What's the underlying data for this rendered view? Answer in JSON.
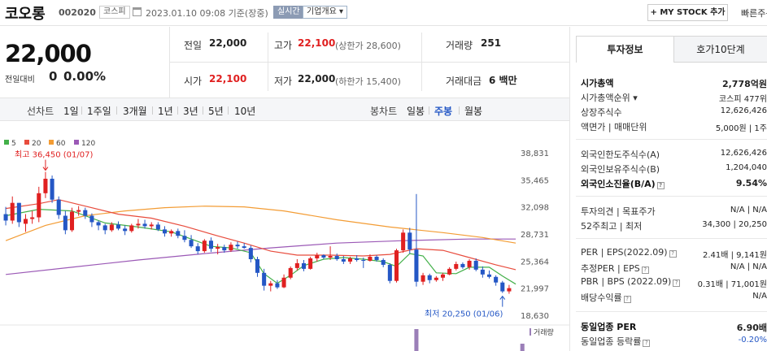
{
  "header": {
    "name": "코오롱",
    "code": "002020",
    "market": "코스피",
    "time": "2023.01.10 09:08 기준(장중)",
    "live": "실시간",
    "overview": "기업개요 ▾",
    "mystock": "+ MY STOCK 추가",
    "quick": "빠른주문"
  },
  "price": {
    "current": "22,000",
    "change_label": "전일대비",
    "change": "0",
    "change_pct": "0.00%"
  },
  "stats": {
    "prev_label": "전일",
    "prev": "22,000",
    "high_label": "고가",
    "high": "22,100",
    "upper_limit": "(상한가 28,600)",
    "volume_label": "거래량",
    "volume": "251",
    "open_label": "시가",
    "open": "22,100",
    "low_label": "저가",
    "low": "22,000",
    "lower_limit": "(하한가 15,400)",
    "amount_label": "거래대금",
    "amount": "6 백만"
  },
  "period": {
    "line_label": "선차트",
    "line_items": [
      "1일",
      "1주일",
      "3개월",
      "1년",
      "3년",
      "5년",
      "10년"
    ],
    "candle_label": "봉차트",
    "candle_items": [
      "일봉",
      "주봉",
      "월봉"
    ],
    "candle_active": "주봉"
  },
  "chart_data": {
    "type": "candlestick",
    "legend": [
      {
        "label": "5",
        "color": "#43b049"
      },
      {
        "label": "20",
        "color": "#e84c3d"
      },
      {
        "label": "60",
        "color": "#f39c34"
      },
      {
        "label": "120",
        "color": "#9b59b6"
      }
    ],
    "yticks": [
      "38,831",
      "35,465",
      "32,098",
      "28,731",
      "25,364",
      "21,997",
      "18,630"
    ],
    "ylim": [
      18630,
      38831
    ],
    "max_annotation": "최고 36,450 (01/07)",
    "min_annotation": "최저 20,250 (01/06)",
    "volume_label": "거래량",
    "colors": {
      "up": "#e02020",
      "down": "#2457c5"
    },
    "candles": [
      [
        31200,
        32100,
        29800,
        30400
      ],
      [
        30400,
        33400,
        30000,
        32600
      ],
      [
        32600,
        32600,
        29600,
        30200
      ],
      [
        30000,
        31200,
        29000,
        30600
      ],
      [
        30600,
        31600,
        30000,
        30800
      ],
      [
        30800,
        34600,
        30200,
        33800
      ],
      [
        33800,
        36450,
        33200,
        35600
      ],
      [
        35600,
        36000,
        32600,
        33000
      ],
      [
        33000,
        33400,
        30600,
        31100
      ],
      [
        31000,
        31600,
        28700,
        29200
      ],
      [
        29200,
        32000,
        29000,
        31500
      ],
      [
        31500,
        32200,
        31000,
        31700
      ],
      [
        31700,
        32000,
        30600,
        31000
      ],
      [
        31000,
        31300,
        29600,
        30200
      ],
      [
        30200,
        30400,
        29200,
        29800
      ],
      [
        29800,
        30000,
        28700,
        29200
      ],
      [
        29200,
        30200,
        29000,
        29900
      ],
      [
        29900,
        30300,
        29200,
        29400
      ],
      [
        29400,
        29800,
        28600,
        29100
      ],
      [
        29100,
        30000,
        28900,
        29800
      ],
      [
        29800,
        30600,
        29400,
        30000
      ],
      [
        30000,
        30500,
        29400,
        29700
      ],
      [
        29700,
        30200,
        29300,
        29900
      ],
      [
        29900,
        30200,
        29100,
        29300
      ],
      [
        29300,
        29700,
        28400,
        28800
      ],
      [
        28800,
        29300,
        28400,
        29100
      ],
      [
        29100,
        29400,
        28200,
        28500
      ],
      [
        28500,
        29200,
        27700,
        28000
      ],
      [
        28000,
        28600,
        27000,
        27200
      ],
      [
        27200,
        27600,
        26200,
        26600
      ],
      [
        26600,
        28100,
        26400,
        27900
      ],
      [
        27900,
        28300,
        26500,
        26900
      ],
      [
        26900,
        27500,
        26200,
        27100
      ],
      [
        27100,
        27400,
        26400,
        26700
      ],
      [
        26700,
        27700,
        26500,
        27400
      ],
      [
        27400,
        27800,
        26900,
        27200
      ],
      [
        27200,
        27600,
        26900,
        27000
      ],
      [
        27000,
        27300,
        25200,
        25600
      ],
      [
        25600,
        25900,
        23400,
        23900
      ],
      [
        23900,
        24400,
        21700,
        22300
      ],
      [
        22300,
        22900,
        21600,
        22600
      ],
      [
        22600,
        23000,
        21900,
        22100
      ],
      [
        22100,
        23700,
        22000,
        23300
      ],
      [
        23300,
        24700,
        23100,
        24500
      ],
      [
        24500,
        25600,
        24200,
        25100
      ],
      [
        25100,
        25500,
        24100,
        24400
      ],
      [
        24400,
        25900,
        24300,
        25700
      ],
      [
        25700,
        26400,
        25300,
        26100
      ],
      [
        26100,
        26200,
        25600,
        25800
      ],
      [
        25800,
        27200,
        25500,
        26000
      ],
      [
        26000,
        26300,
        25400,
        25600
      ],
      [
        25600,
        26000,
        25000,
        25300
      ],
      [
        25300,
        25900,
        25000,
        25700
      ],
      [
        25700,
        26100,
        25300,
        25500
      ],
      [
        25500,
        25800,
        24500,
        25400
      ],
      [
        25400,
        26200,
        25300,
        25900
      ],
      [
        25900,
        26100,
        25300,
        25500
      ],
      [
        25500,
        25700,
        24600,
        24900
      ],
      [
        24900,
        25100,
        22600,
        22900
      ],
      [
        22900,
        26900,
        22700,
        26700
      ],
      [
        26700,
        29300,
        26400,
        28900
      ],
      [
        28900,
        29500,
        26300,
        26800
      ],
      [
        26800,
        33700,
        22200,
        22800
      ],
      [
        22800,
        23900,
        22400,
        23600
      ],
      [
        23600,
        23800,
        22600,
        23000
      ],
      [
        23000,
        23500,
        22800,
        23300
      ],
      [
        23300,
        23900,
        22900,
        23700
      ],
      [
        23700,
        24600,
        23600,
        24400
      ],
      [
        24400,
        25300,
        24200,
        25000
      ],
      [
        25000,
        25200,
        24400,
        24600
      ],
      [
        24600,
        25600,
        24300,
        25400
      ],
      [
        25400,
        25700,
        24100,
        24300
      ],
      [
        24300,
        24700,
        23300,
        23700
      ],
      [
        23700,
        24200,
        23200,
        23400
      ],
      [
        23400,
        23600,
        22300,
        22700
      ],
      [
        22700,
        22900,
        21400,
        21600
      ],
      [
        21600,
        22400,
        21300,
        22000
      ]
    ],
    "ma5": [
      [
        0,
        31000
      ],
      [
        5,
        31800
      ],
      [
        10,
        31600
      ],
      [
        15,
        30100
      ],
      [
        20,
        29600
      ],
      [
        25,
        29000
      ],
      [
        28,
        28100
      ],
      [
        31,
        27200
      ],
      [
        34,
        27000
      ],
      [
        37,
        26400
      ],
      [
        39,
        23800
      ],
      [
        41,
        22600
      ],
      [
        43,
        23600
      ],
      [
        45,
        24800
      ],
      [
        48,
        25600
      ],
      [
        51,
        25800
      ],
      [
        54,
        25600
      ],
      [
        57,
        25300
      ],
      [
        59,
        24700
      ],
      [
        61,
        26300
      ],
      [
        63,
        26000
      ],
      [
        65,
        23900
      ],
      [
        68,
        23800
      ],
      [
        70,
        24600
      ],
      [
        73,
        24600
      ],
      [
        75,
        23500
      ],
      [
        77,
        22500
      ]
    ],
    "ma20": [
      [
        0,
        31900
      ],
      [
        5,
        32500
      ],
      [
        8,
        33000
      ],
      [
        12,
        32200
      ],
      [
        17,
        31200
      ],
      [
        22,
        30700
      ],
      [
        27,
        29700
      ],
      [
        32,
        28500
      ],
      [
        36,
        27600
      ],
      [
        40,
        26600
      ],
      [
        44,
        26100
      ],
      [
        49,
        26100
      ],
      [
        54,
        26000
      ],
      [
        58,
        26200
      ],
      [
        62,
        26900
      ],
      [
        66,
        26700
      ],
      [
        70,
        25800
      ],
      [
        74,
        24900
      ],
      [
        77,
        24300
      ]
    ],
    "ma60": [
      [
        0,
        27900
      ],
      [
        6,
        29800
      ],
      [
        12,
        31000
      ],
      [
        18,
        31600
      ],
      [
        24,
        32000
      ],
      [
        30,
        32200
      ],
      [
        36,
        32100
      ],
      [
        42,
        31600
      ],
      [
        50,
        30500
      ],
      [
        58,
        29600
      ],
      [
        66,
        28900
      ],
      [
        72,
        28300
      ],
      [
        77,
        27600
      ]
    ],
    "ma120": [
      [
        0,
        23700
      ],
      [
        10,
        24600
      ],
      [
        20,
        25500
      ],
      [
        30,
        26300
      ],
      [
        40,
        27000
      ],
      [
        50,
        27600
      ],
      [
        60,
        27900
      ],
      [
        70,
        28100
      ],
      [
        77,
        28100
      ]
    ],
    "volume": [
      [
        62,
        0.9
      ],
      [
        78,
        0.3
      ]
    ]
  },
  "side": {
    "tabs": [
      "투자정보",
      "호가10단계"
    ],
    "rows": [
      {
        "k": "시가총액",
        "v": "2,778억원",
        "kb": true,
        "vb": true
      },
      {
        "k": "시가총액순위 ▾",
        "v": "코스피 477위"
      },
      {
        "k": "상장주식수",
        "v": "12,626,426"
      },
      {
        "k": "액면가 | 매매단위",
        "v": "5,000원 | 1주"
      },
      {
        "k": "외국인한도주식수(A)",
        "v": "12,626,426"
      },
      {
        "k": "외국인보유주식수(B)",
        "v": "1,204,040"
      },
      {
        "k": "외국인소진율(B/A)",
        "v": "9.54%",
        "kb": true,
        "vb": true,
        "icon": true
      },
      {
        "k": "투자의견 | 목표주가",
        "v": "N/A | N/A"
      },
      {
        "k": "52주최고 | 최저",
        "v": "34,300 | 20,250"
      },
      {
        "k": "PER | EPS(2022.09)",
        "v": "2.41배 | 9,141원",
        "icon": true
      },
      {
        "k": "추정PER | EPS",
        "v": "N/A | N/A",
        "icon": true
      },
      {
        "k": "PBR | BPS (2022.09)",
        "v": "0.31배 | 71,001원",
        "icon": true
      },
      {
        "k": "배당수익률",
        "v": "N/A",
        "icon": true
      },
      {
        "k": "동일업종 PER",
        "v": "6.90배",
        "kb": true,
        "vb": true
      },
      {
        "k": "동일업종 등락률",
        "v": "-0.20%",
        "blue": true,
        "icon": true
      }
    ]
  }
}
